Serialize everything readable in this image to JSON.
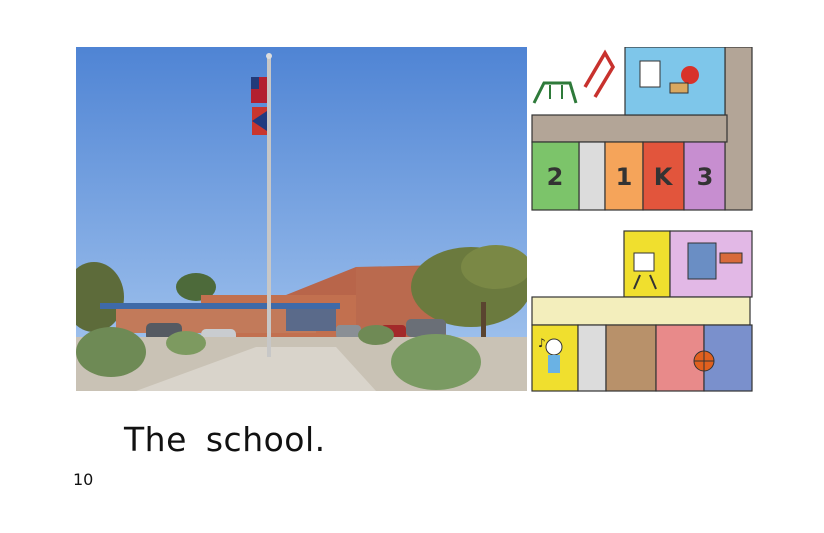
{
  "page": {
    "caption": "The school.",
    "page_number": "10"
  },
  "map": {
    "rooms": [
      {
        "label": "2",
        "color": "#7cc46a"
      },
      {
        "label": "1",
        "color": "#f5a45a"
      },
      {
        "label": "K",
        "color": "#e2553c"
      },
      {
        "label": "3",
        "color": "#c78ed0"
      }
    ],
    "hallway_color": "#b8a898",
    "lower_hallway_color": "#f3eebc",
    "icons": [
      "swing-icon",
      "slide-icon",
      "lunch-icon",
      "easel-icon",
      "books-icon",
      "music-icon",
      "basketball-icon"
    ]
  }
}
